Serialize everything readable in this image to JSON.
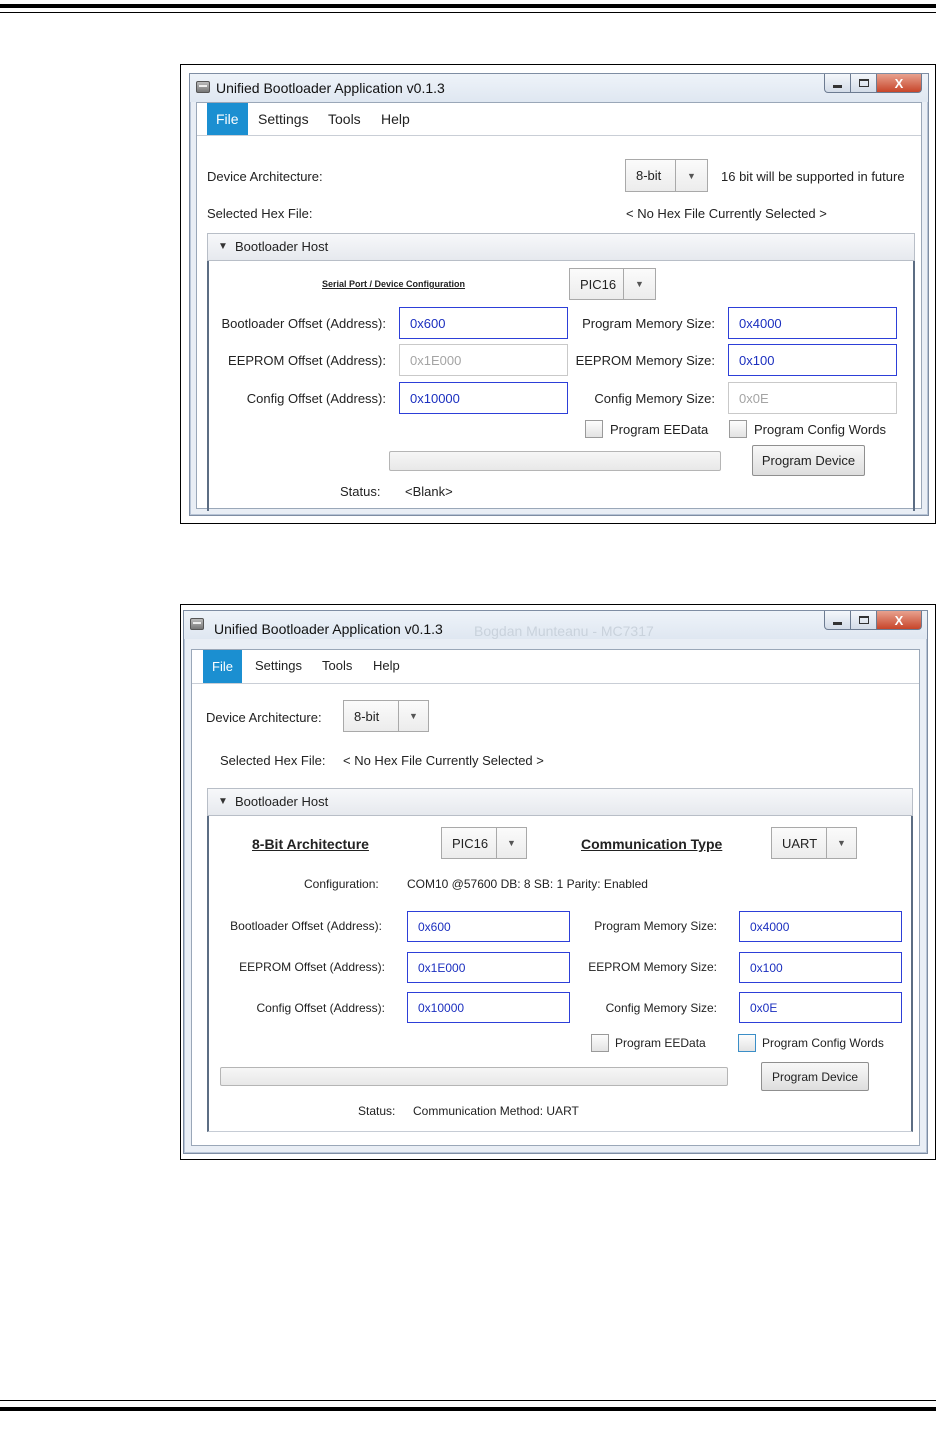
{
  "screenshots": [
    {
      "window_title": "Unified Bootloader Application v0.1.3",
      "window_controls": {
        "minimize_icon": "minimize-icon",
        "maximize_icon": "maximize-icon",
        "close_glyph": "X"
      },
      "menu": {
        "file": "File",
        "settings": "Settings",
        "tools": "Tools",
        "help": "Help"
      },
      "device_architecture": {
        "label": "Device Architecture:",
        "value": "8-bit",
        "note": "16 bit will be supported in future"
      },
      "hex_file": {
        "label": "Selected Hex File:",
        "value": "< No Hex File Currently Selected >"
      },
      "bootloader_host": {
        "header": "Bootloader Host",
        "serial_config_label": "Serial Port / Device Configuration",
        "device_family": "PIC16",
        "bootloader_offset": {
          "label": "Bootloader Offset (Address):",
          "value": "0x600"
        },
        "eeprom_offset": {
          "label": "EEPROM Offset (Address):",
          "value": "0x1E000"
        },
        "config_offset": {
          "label": "Config Offset (Address):",
          "value": "0x10000"
        },
        "program_memory_size": {
          "label": "Program Memory Size:",
          "value": "0x4000"
        },
        "eeprom_memory_size": {
          "label": "EEPROM Memory Size:",
          "value": "0x100"
        },
        "config_memory_size": {
          "label": "Config Memory Size:",
          "value": "0x0E"
        },
        "program_eedata": "Program EEData",
        "program_config_words": "Program Config Words",
        "program_device": "Program Device",
        "status_label": "Status:",
        "status_value": "<Blank>"
      }
    },
    {
      "window_title": "Unified Bootloader Application v0.1.3",
      "title_ghost": "Bogdan Munteanu - MC7317",
      "window_controls": {
        "minimize_icon": "minimize-icon",
        "maximize_icon": "maximize-icon",
        "close_glyph": "X"
      },
      "menu": {
        "file": "File",
        "settings": "Settings",
        "tools": "Tools",
        "help": "Help"
      },
      "device_architecture": {
        "label": "Device Architecture:",
        "value": "8-bit"
      },
      "hex_file": {
        "label": "Selected Hex File:",
        "value": "< No Hex File Currently Selected >"
      },
      "bootloader_host": {
        "header": "Bootloader Host",
        "architecture_label": "8-Bit Architecture",
        "device_family": "PIC16",
        "comm_type_label": "Communication Type",
        "comm_type": "UART",
        "configuration_label": "Configuration:",
        "configuration_value": "COM10 @57600 DB: 8 SB: 1 Parity: Enabled",
        "bootloader_offset": {
          "label": "Bootloader Offset (Address):",
          "value": "0x600"
        },
        "eeprom_offset": {
          "label": "EEPROM Offset (Address):",
          "value": "0x1E000"
        },
        "config_offset": {
          "label": "Config Offset (Address):",
          "value": "0x10000"
        },
        "program_memory_size": {
          "label": "Program Memory Size:",
          "value": "0x4000"
        },
        "eeprom_memory_size": {
          "label": "EEPROM Memory Size:",
          "value": "0x100"
        },
        "config_memory_size": {
          "label": "Config Memory Size:",
          "value": "0x0E"
        },
        "program_eedata": "Program EEData",
        "program_config_words": "Program Config Words",
        "program_device": "Program Device",
        "status_label": "Status:",
        "status_value": "Communication Method: UART"
      }
    }
  ]
}
